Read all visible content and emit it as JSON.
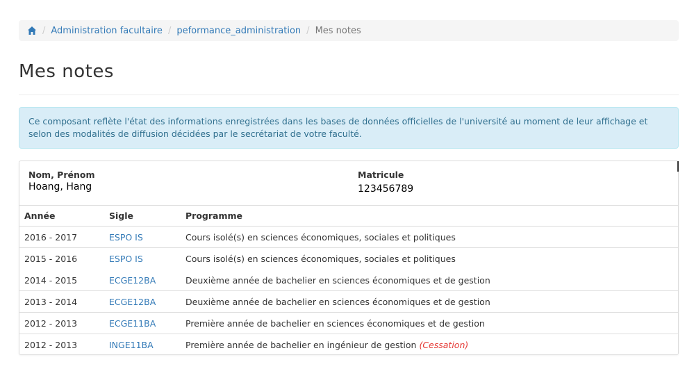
{
  "breadcrumb": {
    "items": [
      "Administration facultaire",
      "peformance_administration"
    ],
    "current": "Mes notes",
    "separator": "/"
  },
  "page": {
    "title": "Mes notes",
    "info_alert": "Ce composant reflète l'état des informations enregistrées dans les bases de données officielles de l'université au moment de leur affichage et selon des modalités de diffusion décidées par le secrétariat de votre faculté."
  },
  "student": {
    "name_label": "Nom, Prénom",
    "name": "Hoang, Hang",
    "matricule_label": "Matricule",
    "matricule": "123456789"
  },
  "table": {
    "headers": [
      "Année",
      "Sigle",
      "Programme"
    ],
    "rows": [
      {
        "annee": "2016 - 2017",
        "sigle": "ESPO IS",
        "programme": "Cours isolé(s) en sciences économiques, sociales et politiques",
        "status": ""
      },
      {
        "annee": "2015 - 2016",
        "sigle": "ESPO IS",
        "programme": "Cours isolé(s) en sciences économiques, sociales et politiques",
        "status": ""
      },
      {
        "annee": "2014 - 2015",
        "sigle": "ECGE12BA",
        "programme": "Deuxième année de bachelier en sciences économiques et de gestion",
        "status": ""
      },
      {
        "annee": "2013 - 2014",
        "sigle": "ECGE12BA",
        "programme": "Deuxième année de bachelier en sciences économiques et de gestion",
        "status": ""
      },
      {
        "annee": "2012 - 2013",
        "sigle": "ECGE11BA",
        "programme": "Première année de bachelier en sciences économiques et de gestion",
        "status": ""
      },
      {
        "annee": "2012 - 2013",
        "sigle": "INGE11BA",
        "programme": "Première année de bachelier en ingénieur de gestion",
        "status": "(Cessation)"
      }
    ]
  },
  "colors": {
    "link": "#337ab7",
    "alert_bg": "#d9edf7",
    "alert_text": "#31708f",
    "status_red": "#e53935"
  },
  "icons": {
    "home": "home-icon"
  }
}
